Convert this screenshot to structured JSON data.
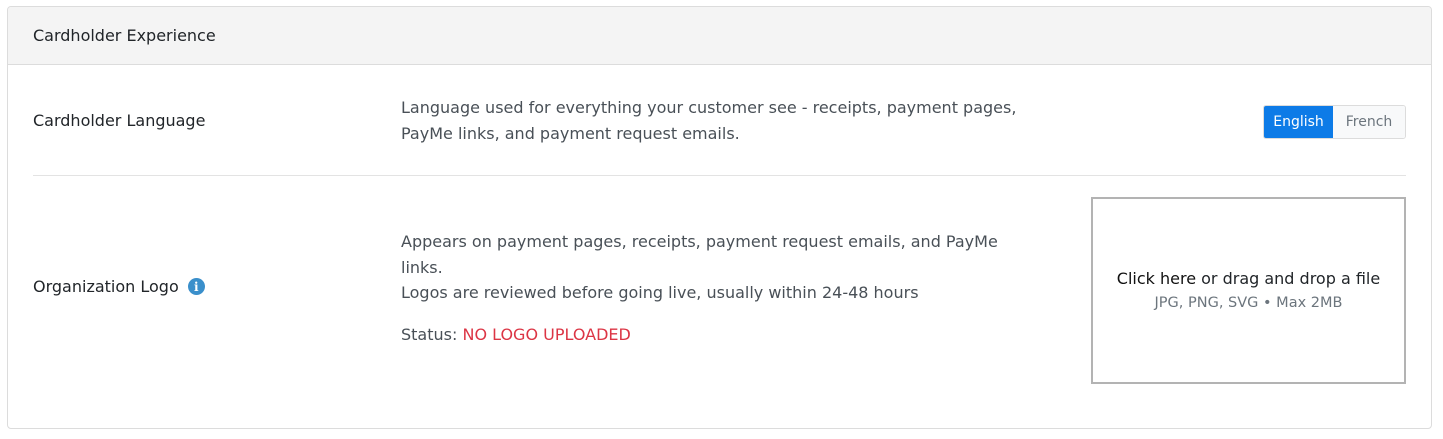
{
  "header": {
    "title": "Cardholder Experience"
  },
  "language": {
    "label": "Cardholder Language",
    "description": "Language used for everything your customer see - receipts, payment pages, PayMe links, and payment request emails.",
    "options": [
      "English",
      "French"
    ],
    "selected": "English"
  },
  "logo": {
    "label": "Organization Logo",
    "info_icon": "info-icon",
    "description_line1": "Appears on payment pages, receipts, payment request emails, and PayMe links.",
    "description_line2": "Logos are reviewed before going live, usually within 24-48 hours",
    "status_label": "Status:",
    "status_value": "NO LOGO UPLOADED",
    "upload": {
      "click_text": "Click here",
      "drop_text": "or drag and drop a file",
      "hint": "JPG, PNG, SVG • Max 2MB"
    }
  },
  "colors": {
    "accent": "#0d7be7",
    "status_error": "#dc3545",
    "info_icon": "#3a8fcb"
  }
}
